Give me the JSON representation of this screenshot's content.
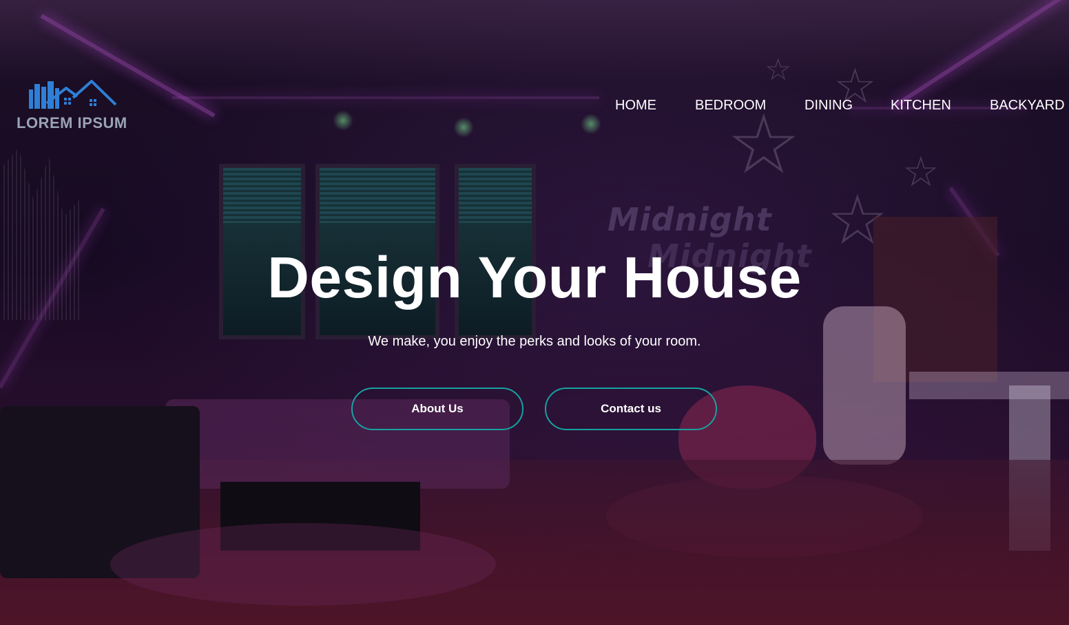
{
  "brand": {
    "name": "LOREM IPSUM",
    "logo_icon": "house-skyline-logo",
    "logo_color": "#2f7fd6"
  },
  "nav": {
    "items": [
      {
        "label": "HOME"
      },
      {
        "label": "BEDROOM"
      },
      {
        "label": "DINING"
      },
      {
        "label": "KITCHEN"
      },
      {
        "label": "BACKYARD"
      }
    ]
  },
  "hero": {
    "title": "Design Your House",
    "subtitle": "We make, you enjoy the perks and looks of your room.",
    "buttons": {
      "about": "About Us",
      "contact": "Contact us"
    },
    "background_neon_text": [
      "Midnight",
      "Midnight"
    ]
  },
  "colors": {
    "button_border": "#17a2a0",
    "text": "#ffffff",
    "background": "#1a0a22"
  }
}
